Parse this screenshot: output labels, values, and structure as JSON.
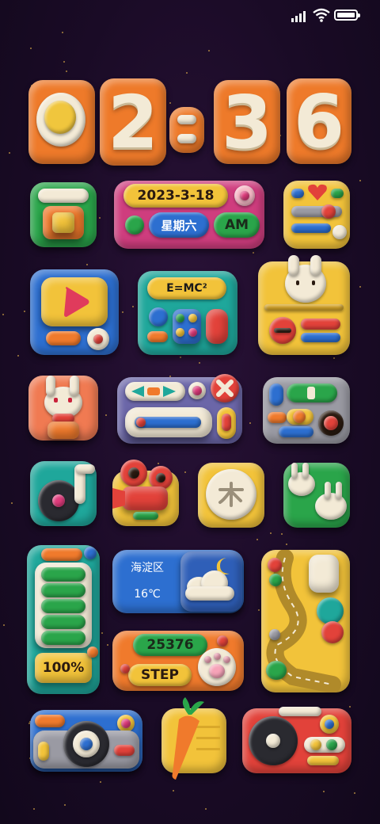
{
  "status_bar": {
    "icons": [
      "signal-icon",
      "wifi-icon",
      "battery-icon"
    ]
  },
  "clock": {
    "digits": [
      "0",
      "2",
      ":",
      "3",
      "6"
    ]
  },
  "date_widget": {
    "date": "2023-3-18",
    "weekday": "星期六",
    "ampm": "AM"
  },
  "formula_widget": {
    "text": "E=MC²"
  },
  "weather_widget": {
    "location": "海淀区",
    "temperature": "16℃",
    "icon": "moon-cloud-icon"
  },
  "steps_widget": {
    "count": "25376",
    "label": "STEP"
  },
  "battery_widget": {
    "percent_label": "100%",
    "level": 1.0
  },
  "apps": [
    "phone-icon",
    "control-panel-icon",
    "video-player-icon",
    "calculator-icon",
    "bunny-pocket-icon",
    "bunny-icon",
    "game-controller-icon",
    "settings-toggle-icon",
    "music-note-icon",
    "movie-camera-icon",
    "kanji-app-icon",
    "bunnies-icon",
    "map-icon",
    "camera-icon",
    "carrot-notes-icon",
    "record-player-icon"
  ],
  "colors": {
    "orange": "#f07a2c",
    "cream": "#f3ead6",
    "yellow": "#f2c33a",
    "green": "#2aa54a",
    "teal": "#1fa79b",
    "blue": "#2d6fd0",
    "red": "#e2423a",
    "pink": "#e03b7c",
    "grey": "#9a9aa3"
  }
}
